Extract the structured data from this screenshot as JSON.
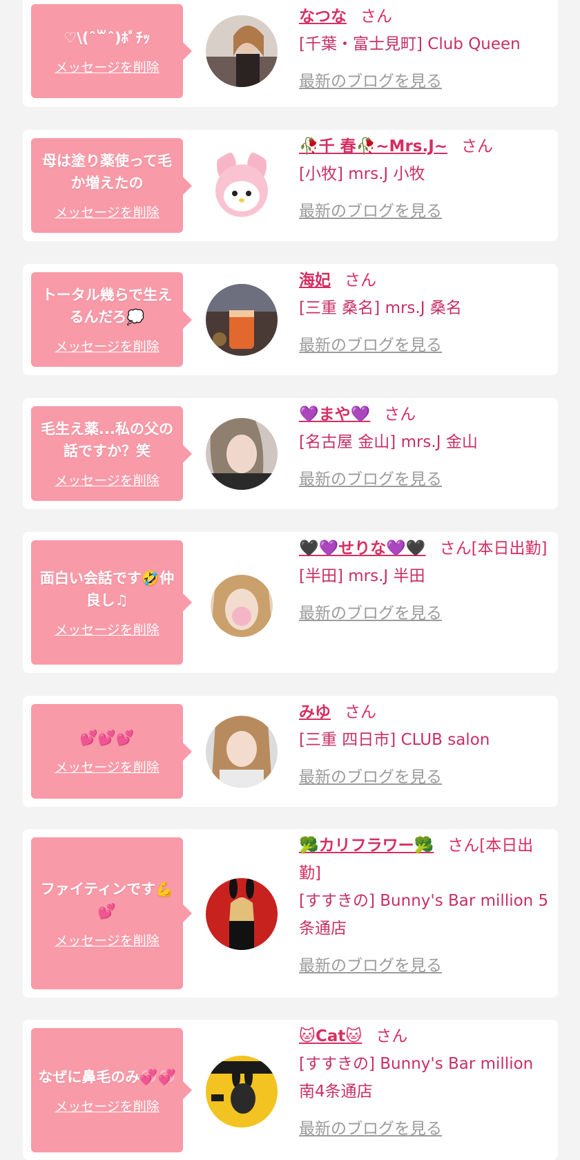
{
  "labels": {
    "delete": "メッセージを削除",
    "blog": "最新のブログを見る",
    "san": "さん"
  },
  "items": [
    {
      "message": "♡\\(ˆ꒳ˆ)ﾎﾟﾁｯ",
      "name": "なつな",
      "san": "さん",
      "shop": "[千葉・富士見町] Club Queen",
      "avatar_icon": "photo-avatar-1"
    },
    {
      "message": "母は塗り薬使って毛か増えたの",
      "name": "🥀千 春🥀~Mrs.J~",
      "san": "さん",
      "shop": "[小牧] mrs.J 小牧",
      "avatar_icon": "plush-avatar"
    },
    {
      "message": "トータル幾らで生えるんだろ💭",
      "name": "海妃",
      "san": "さん",
      "shop": "[三重 桑名] mrs.J 桑名",
      "avatar_icon": "photo-avatar-3"
    },
    {
      "message": "毛生え薬...私の父の話ですか？笑",
      "name": "💜まや💜",
      "san": "さん",
      "shop": "[名古屋 金山] mrs.J 金山",
      "avatar_icon": "photo-avatar-4"
    },
    {
      "message": "面白い会話です🤣仲良し♫",
      "name": "🖤💜せりな💜🖤",
      "san": "さん[本日出勤]",
      "shop": "[半田] mrs.J 半田",
      "avatar_icon": "photo-avatar-5"
    },
    {
      "message": "💕💕💕",
      "name": "みゆ",
      "san": "さん",
      "shop": "[三重 四日市] CLUB salon",
      "avatar_icon": "photo-avatar-6"
    },
    {
      "message": "ファイティンです💪💕",
      "name": "🥦カリフラワー🥦",
      "san": "さん[本日出勤]",
      "shop": "[すすきの] Bunny's Bar million 5条通店",
      "avatar_icon": "photo-avatar-7"
    },
    {
      "message": "なぜに鼻毛のみ💞💞",
      "name": "🐱Cat🐱",
      "san": "さん",
      "shop": "[すすきの] Bunny's Bar million 南4条通店",
      "avatar_icon": "magazine-avatar"
    }
  ]
}
